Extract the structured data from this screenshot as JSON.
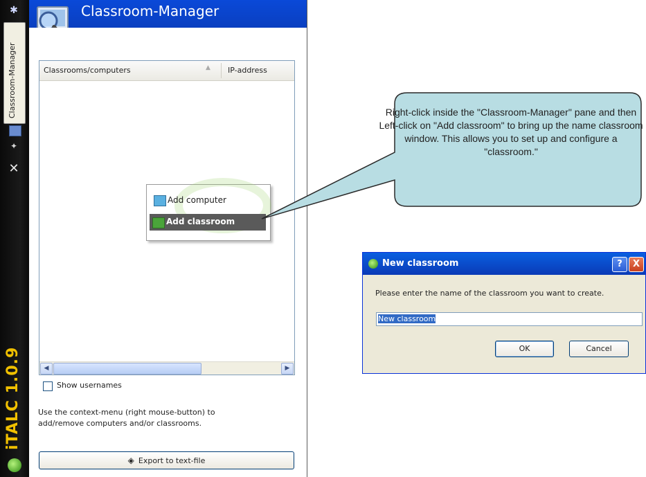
{
  "app": {
    "title": "Classroom-Manager",
    "version_label": "iTALC 1.0.9",
    "side_tab_label": "Classroom-Manager"
  },
  "list": {
    "col_classrooms": "Classrooms/computers",
    "col_ip": "IP-address"
  },
  "options": {
    "show_usernames_label": "Show usernames",
    "show_usernames_checked": false
  },
  "help_text": "Use the context-menu (right mouse-button) to add/remove computers and/or classrooms.",
  "export_button": "Export to text-file",
  "context_menu": {
    "items": [
      {
        "label": "Add computer",
        "icon": "add-computer-icon"
      },
      {
        "label": "Add classroom",
        "icon": "add-classroom-icon"
      }
    ]
  },
  "callout": {
    "text": "Right-click inside the \"Classroom-Manager\" pane and then Left-click on \"Add classroom\" to bring up the name classroom window.  This allows you to set up and configure a \"classroom.\""
  },
  "dialog": {
    "title": "New classroom",
    "prompt": "Please enter the name of the classroom you want to create.",
    "input_value": "New classroom",
    "ok": "OK",
    "cancel": "Cancel",
    "help_glyph": "?",
    "close_glyph": "X"
  },
  "colors": {
    "header_blue": "#0a49d8",
    "sidebar_black": "#0a0a0a",
    "version_yellow": "#f0c000",
    "callout_fill": "#b8dde3",
    "menu_highlight": "#5a5a5a"
  }
}
